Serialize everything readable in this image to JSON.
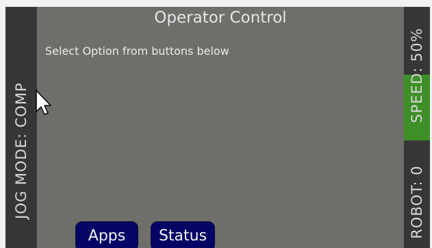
{
  "header": {
    "title": "Operator Control"
  },
  "main": {
    "prompt": "Select Option from buttons below"
  },
  "left_bar": {
    "jog_mode": "JOG MODE: COMP"
  },
  "right_bar": {
    "speed": "SPEED: 50%",
    "robot": "ROBOT: 0"
  },
  "buttons": {
    "apps": "Apps",
    "status": "Status"
  },
  "colors": {
    "panel": "#6e6e6b",
    "side": "#363636",
    "speed_highlight": "#3e8f28",
    "button": "#050566"
  },
  "icons": {
    "cursor": "mouse-pointer-icon"
  }
}
